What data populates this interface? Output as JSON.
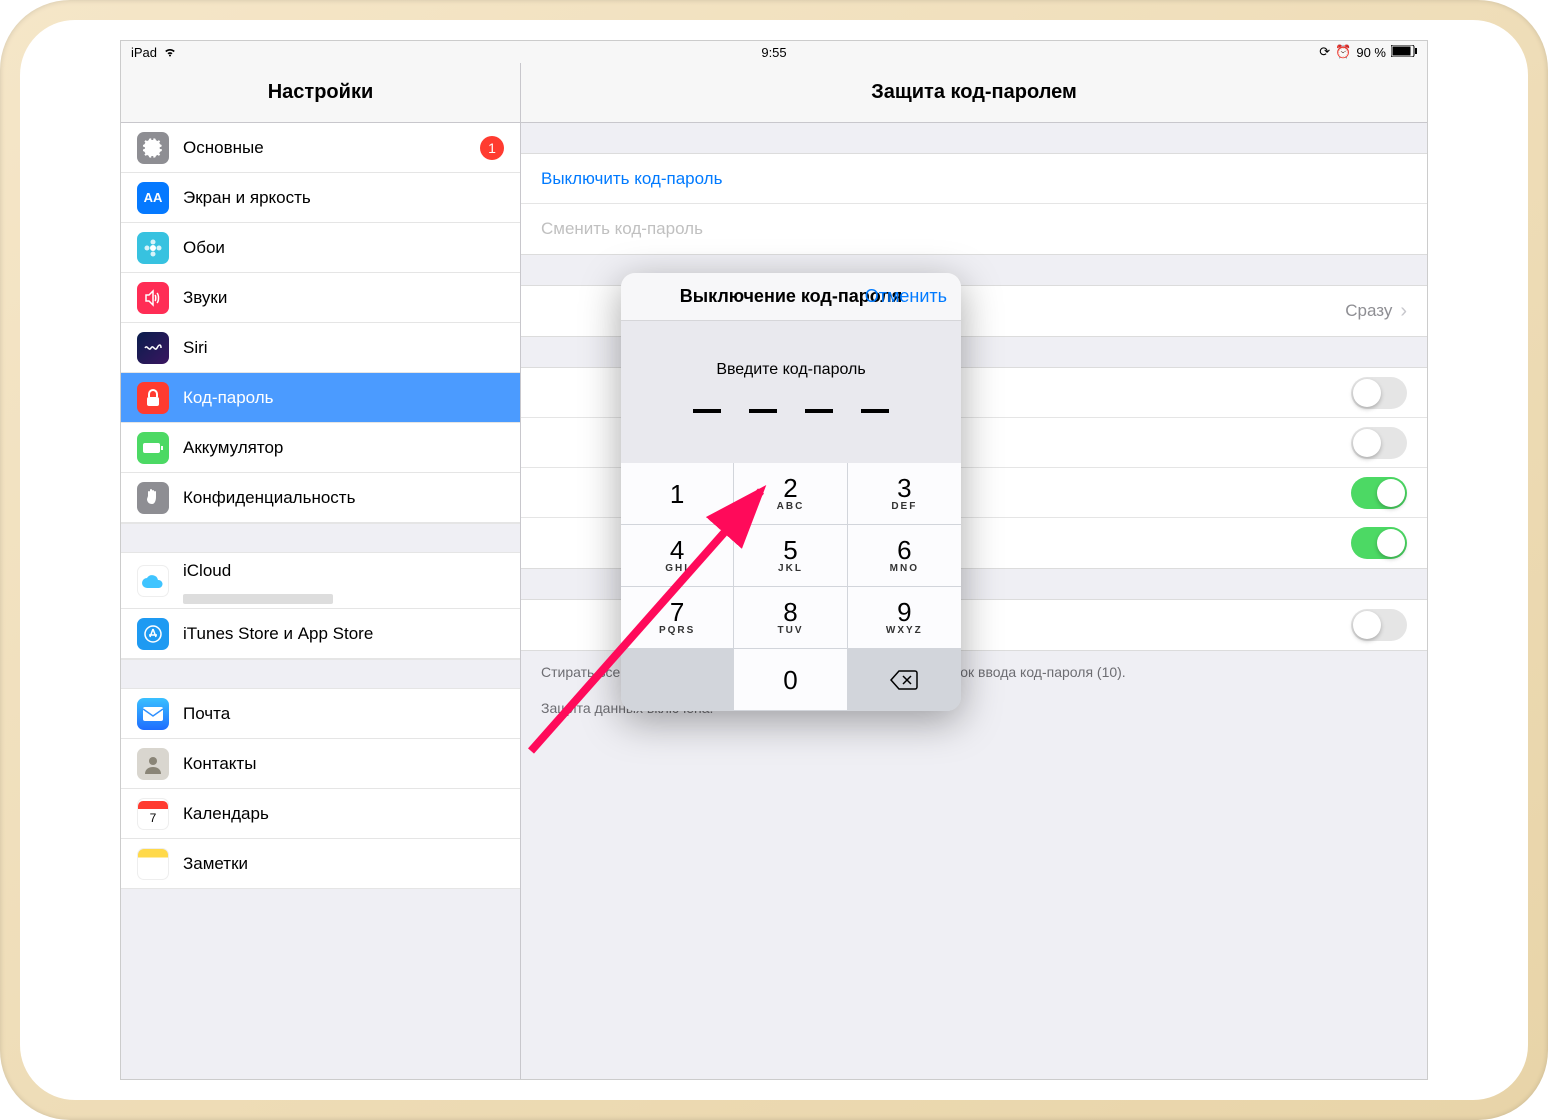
{
  "statusbar": {
    "device": "iPad",
    "time": "9:55",
    "battery": "90 %"
  },
  "sidebar": {
    "title": "Настройки",
    "items": [
      {
        "label": "Основные",
        "icon": "gear",
        "color": "#8e8e93",
        "badge": "1"
      },
      {
        "label": "Экран и яркость",
        "icon": "AA",
        "color": "#0579ff"
      },
      {
        "label": "Обои",
        "icon": "flower",
        "color": "#37c2e0"
      },
      {
        "label": "Звуки",
        "icon": "speaker",
        "color": "#ff2d55"
      },
      {
        "label": "Siri",
        "icon": "siri",
        "color": "#1b1b2b"
      },
      {
        "label": "Код-пароль",
        "icon": "lock",
        "color": "#ff3b30",
        "active": true
      },
      {
        "label": "Аккумулятор",
        "icon": "battery",
        "color": "#4cd964"
      },
      {
        "label": "Конфиденциальность",
        "icon": "hand",
        "color": "#8e8e93"
      }
    ],
    "items2": [
      {
        "label": "iCloud",
        "icon": "cloud",
        "color": "#fff"
      },
      {
        "label": "iTunes Store и App Store",
        "icon": "appstore",
        "color": "#1e9af2"
      }
    ],
    "items3": [
      {
        "label": "Почта",
        "icon": "mail",
        "color": "#1f8cff"
      },
      {
        "label": "Контакты",
        "icon": "contact",
        "color": "#d9d6cf"
      },
      {
        "label": "Календарь",
        "icon": "calendar",
        "color": "#fff"
      },
      {
        "label": "Заметки",
        "icon": "notes",
        "color": "#fff"
      }
    ]
  },
  "main": {
    "title": "Защита код-паролем",
    "disable": "Выключить код-пароль",
    "change": "Сменить код-пароль",
    "require_val": "Сразу",
    "erase_hint": "Стирать все данные на iPad после нескольких неудачных попыток ввода код-пароля (10).",
    "protect_hint": "Защита данных включена."
  },
  "popover": {
    "title": "Выключение код-пароля",
    "cancel": "Отменить",
    "prompt": "Введите код-пароль",
    "keys": [
      {
        "n": "1",
        "l": ""
      },
      {
        "n": "2",
        "l": "ABC"
      },
      {
        "n": "3",
        "l": "DEF"
      },
      {
        "n": "4",
        "l": "GHI"
      },
      {
        "n": "5",
        "l": "JKL"
      },
      {
        "n": "6",
        "l": "MNO"
      },
      {
        "n": "7",
        "l": "PQRS"
      },
      {
        "n": "8",
        "l": "TUV"
      },
      {
        "n": "9",
        "l": "WXYZ"
      }
    ],
    "zero": "0"
  }
}
